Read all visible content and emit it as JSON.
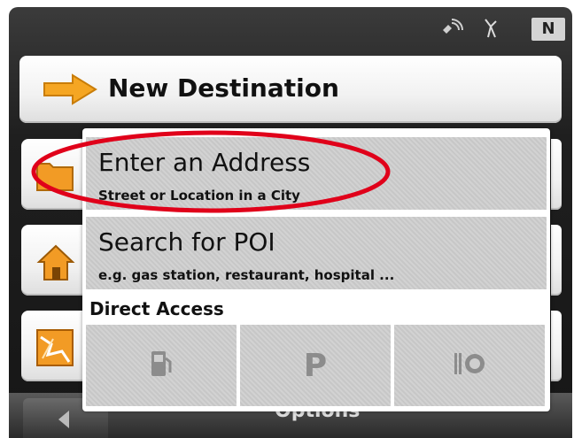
{
  "status_bar": {
    "compass_heading": "N",
    "icons": [
      "gps-signal-icon",
      "satellite-icon"
    ]
  },
  "menu": {
    "new_destination_label": "New Destination",
    "side_icons": [
      "folder-icon",
      "home-icon",
      "map-icon"
    ]
  },
  "popup": {
    "items": [
      {
        "title": "Enter an Address",
        "subtitle": "Street or Location in a City"
      },
      {
        "title": "Search for POI",
        "subtitle": "e.g. gas station, restaurant, hospital ..."
      }
    ],
    "direct_access_label": "Direct Access",
    "quick_buttons": [
      "fuel-pump-icon",
      "parking-icon",
      "restaurant-icon"
    ],
    "parking_glyph": "P"
  },
  "bottom_bar": {
    "options_label": "Options"
  },
  "colors": {
    "arrow": "#f5a623",
    "highlight": "#e0001a",
    "quick_icon": "#8c8c8c"
  }
}
